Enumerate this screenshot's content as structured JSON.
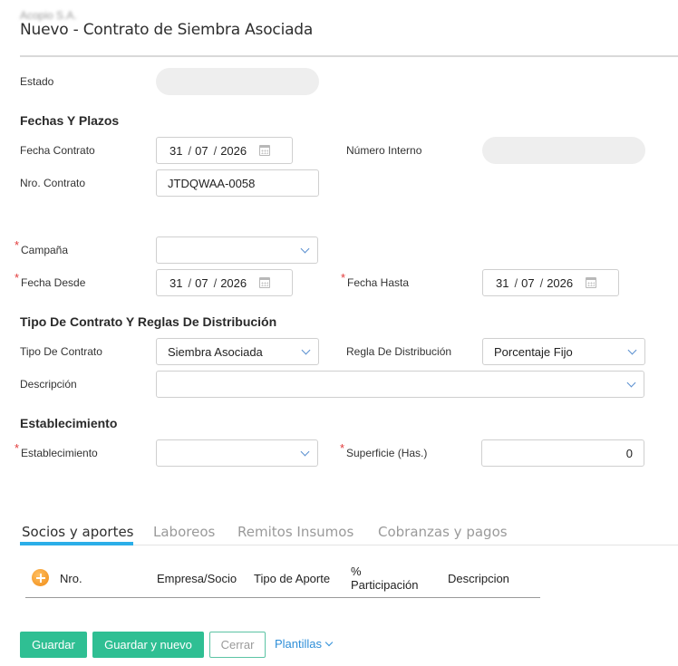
{
  "header": {
    "company": "Acopio S.A.",
    "title": "Nuevo - Contrato de Siembra Asociada"
  },
  "form": {
    "estado": {
      "label": "Estado",
      "value": ""
    },
    "fechas_section": "Fechas Y Plazos",
    "fecha_contrato": {
      "label": "Fecha Contrato",
      "day": "31",
      "month": "07",
      "year": "2026"
    },
    "numero_interno": {
      "label": "Número Interno",
      "value": ""
    },
    "nro_contrato": {
      "label": "Nro. Contrato",
      "value": "JTDQWAA-0058"
    },
    "campana": {
      "label": "Campaña",
      "value": ""
    },
    "fecha_desde": {
      "label": "Fecha Desde",
      "day": "31",
      "month": "07",
      "year": "2026"
    },
    "fecha_hasta": {
      "label": "Fecha Hasta",
      "day": "31",
      "month": "07",
      "year": "2026"
    },
    "tipo_section": "Tipo De Contrato Y Reglas De Distribución",
    "tipo_contrato": {
      "label": "Tipo De Contrato",
      "value": "Siembra Asociada"
    },
    "regla_distribucion": {
      "label": "Regla De Distribución",
      "value": "Porcentaje Fijo"
    },
    "descripcion": {
      "label": "Descripción",
      "value": ""
    },
    "establecimiento_section": "Establecimiento",
    "establecimiento": {
      "label": "Establecimiento",
      "value": ""
    },
    "superficie": {
      "label": "Superficie (Has.)",
      "value": "0"
    }
  },
  "tabs": [
    {
      "label": "Socios y aportes",
      "active": true
    },
    {
      "label": "Laboreos",
      "active": false
    },
    {
      "label": "Remitos Insumos",
      "active": false
    },
    {
      "label": "Cobranzas y pagos",
      "active": false
    }
  ],
  "grid": {
    "columns": [
      "Nro.",
      "Empresa/Socio",
      "Tipo de Aporte",
      "% Participación",
      "Descripcion"
    ],
    "participacion_line1": "%",
    "participacion_line2": "Participación"
  },
  "actions": {
    "guardar": "Guardar",
    "guardar_nuevo": "Guardar y nuevo",
    "cerrar": "Cerrar",
    "plantillas": "Plantillas"
  },
  "date_separator": "/",
  "colors": {
    "primary": "#2fbf93",
    "accent_tab": "#2baee8",
    "link": "#2f8fd8",
    "required": "#e23b3b",
    "add_icon": "#f08a12"
  }
}
